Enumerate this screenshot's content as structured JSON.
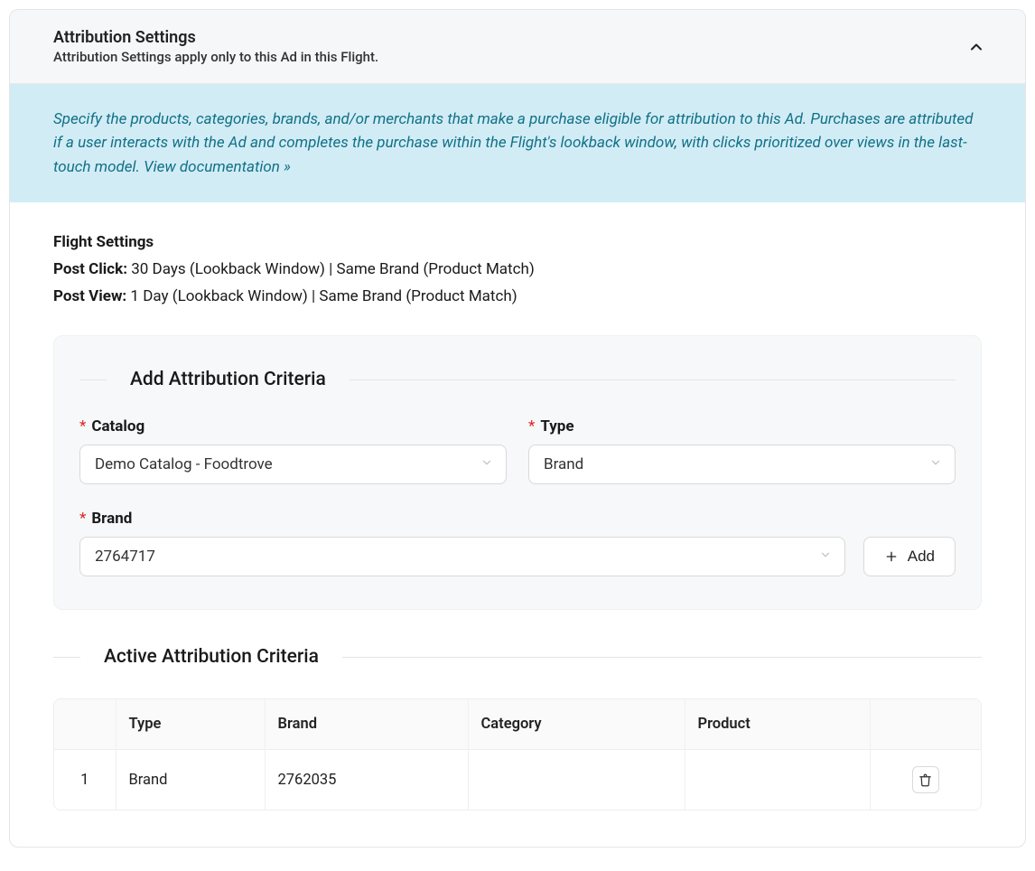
{
  "panel": {
    "title": "Attribution Settings",
    "subtitle": "Attribution Settings apply only to this Ad in this Flight."
  },
  "banner": {
    "text": "Specify the products, categories, brands, and/or merchants that make a purchase eligible for attribution to this Ad. Purchases are attributed if a user interacts with the Ad and completes the purchase within the Flight's lookback window, with clicks prioritized over views in the last-touch model.  ",
    "link_text": "View documentation »"
  },
  "flight_settings": {
    "heading": "Flight Settings",
    "post_click_label": "Post Click:",
    "post_click_value": " 30 Days (Lookback Window) | Same Brand (Product Match)",
    "post_view_label": "Post View:",
    "post_view_value": " 1 Day (Lookback Window) | Same Brand (Product Match)"
  },
  "add_section": {
    "legend": "Add Attribution Criteria",
    "catalog_label": "Catalog",
    "catalog_value": "Demo Catalog - Foodtrove",
    "type_label": "Type",
    "type_value": "Brand",
    "brand_label": "Brand",
    "brand_value": "2764717",
    "add_button": "Add"
  },
  "active_section": {
    "legend": "Active Attribution Criteria",
    "columns": {
      "index": "",
      "type": "Type",
      "brand": "Brand",
      "category": "Category",
      "product": "Product",
      "actions": ""
    },
    "rows": [
      {
        "index": "1",
        "type": "Brand",
        "brand": "2762035",
        "category": "",
        "product": ""
      }
    ]
  }
}
